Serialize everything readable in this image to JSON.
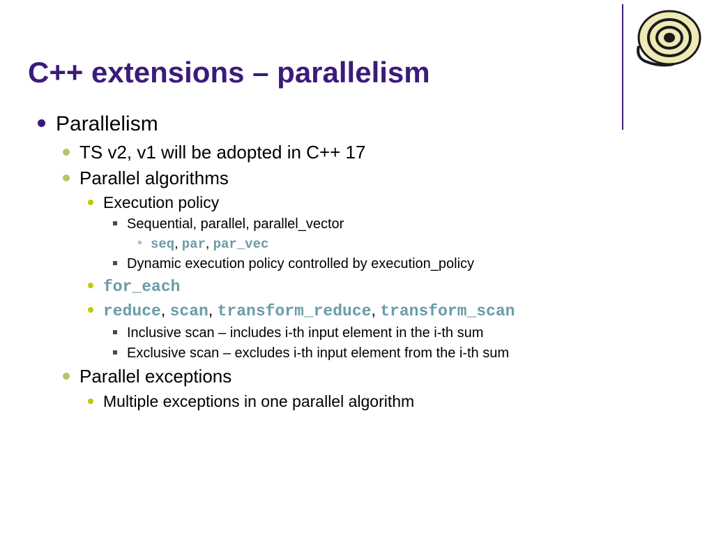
{
  "title": "C++ extensions – parallelism",
  "bullets": {
    "l1_1": "Parallelism",
    "l2_1": "TS v2, v1 will be adopted in C++ 17",
    "l2_2": "Parallel algorithms",
    "l3_1": "Execution policy",
    "l4_1": "Sequential, parallel, parallel_vector",
    "l5_1a": "seq",
    "l5_1b": "par",
    "l5_1c": "par_vec",
    "l4_2": "Dynamic execution policy controlled by execution_policy",
    "l3_2": "for_each",
    "l3_3a": "reduce",
    "l3_3b": "scan",
    "l3_3c": "transform_reduce",
    "l3_3d": "transform_scan",
    "l4_3": "Inclusive scan – includes i-th input element in the i-th sum",
    "l4_4": "Exclusive scan – excludes i-th input element from the i-th sum",
    "l2_3": "Parallel exceptions",
    "l3_4": "Multiple exceptions in one parallel algorithm"
  }
}
